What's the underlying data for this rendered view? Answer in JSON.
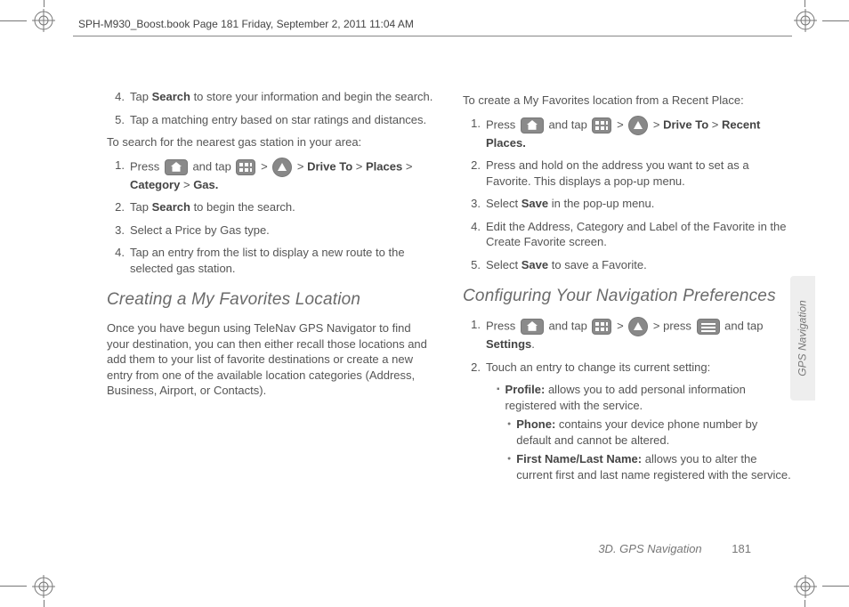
{
  "header": "SPH-M930_Boost.book  Page 181  Friday, September 2, 2011  11:04 AM",
  "left": {
    "step4": "Tap <b>Search</b> to store your information and begin the search.",
    "step5": "Tap a matching entry based on star ratings and distances.",
    "gas_intro": "To search for the nearest gas station in your area:",
    "g1_a": "Press ",
    "g1_b": " and tap ",
    "g1_c": " > ",
    "g1_d": " > <b>Drive To</b> > <b>Places</b> > <b>Category</b> > <b>Gas.</b>",
    "g2": "Tap <b>Search</b> to begin the search.",
    "g3": "Select a Price by Gas type.",
    "g4": "Tap an entry from the list to display a new route to the selected gas station.",
    "h_fav": "Creating a My Favorites Location",
    "fav_para": "Once you have begun using TeleNav GPS Navigator to find your destination, you can then either recall those locations and add them to your list of favorite destinations or create a new entry from one of the available location categories (Address, Business, Airport, or Contacts)."
  },
  "right": {
    "intro": "To create a My Favorites location from a Recent Place:",
    "r1_a": "Press ",
    "r1_b": " and tap ",
    "r1_c": " > ",
    "r1_d": " > <b>Drive To</b> > <b>Recent Places.</b>",
    "r2": "Press and hold on the address you want to set as a Favorite. This displays a pop-up menu.",
    "r3": "Select <b>Save</b> in the pop-up menu.",
    "r4": "Edit the Address, Category and Label of the Favorite in the Create Favorite screen.",
    "r5": "Select <b>Save</b> to save a Favorite.",
    "h_conf": "Configuring Your Navigation Preferences",
    "c1_a": "Press ",
    "c1_b": " and tap ",
    "c1_c": " > ",
    "c1_d": " > press ",
    "c1_e": " and tap <b>Settings</b>.",
    "c2": "Touch an entry to change its current setting:",
    "profile": "<b>Profile:</b> allows you to add personal information registered with the service.",
    "phone": "<b>Phone:</b> contains your device phone number by default and cannot be altered.",
    "name": "<b>First Name/Last Name:</b> allows you to alter the current first and last name registered with the service."
  },
  "side_tab": "GPS Navigation",
  "footer_section": "3D. GPS Navigation",
  "footer_page": "181"
}
